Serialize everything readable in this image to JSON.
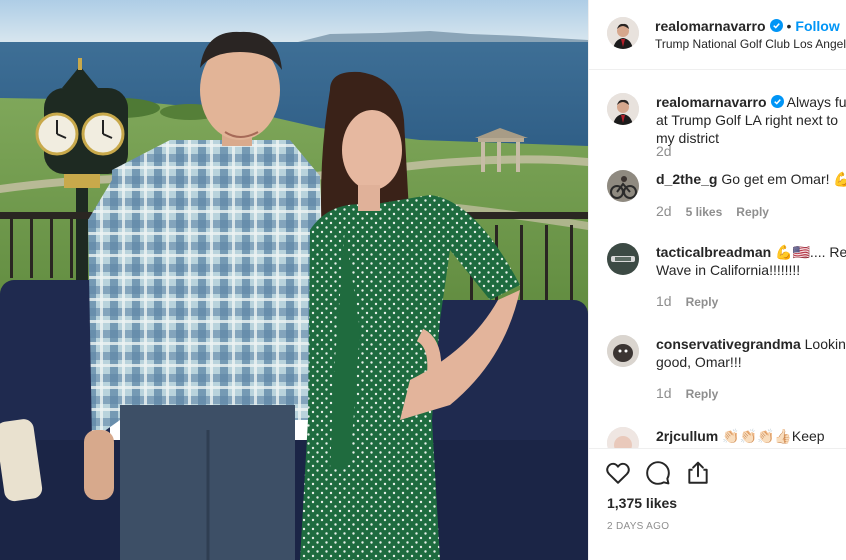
{
  "post": {
    "username": "realomarnavarro",
    "separator": "•",
    "follow_label": "Follow",
    "location": "Trump National Golf Club Los Angeles"
  },
  "comments": [
    {
      "username": "realomarnavarro",
      "text": "Always fun at Trump Golf LA right next to my district",
      "age": "2d",
      "likes": "",
      "reply": ""
    },
    {
      "username": "d_2the_g",
      "text": "Go get em Omar! 💪",
      "age": "2d",
      "likes": "5 likes",
      "reply": "Reply"
    },
    {
      "username": "tacticalbreadman",
      "text": "💪🇺🇸.... Red Wave in California!!!!!!!!",
      "age": "1d",
      "likes": "",
      "reply": "Reply"
    },
    {
      "username": "conservativegrandma",
      "text": "Looking good, Omar!!!",
      "age": "1d",
      "likes": "",
      "reply": "Reply"
    },
    {
      "username": "2rjcullum",
      "text": "👏🏻👏🏻👏🏻👍🏻Keep going",
      "age": "",
      "likes": "",
      "reply": ""
    }
  ],
  "actions": {
    "like_icon": "heart-icon",
    "comment_icon": "comment-icon",
    "share_icon": "share-icon"
  },
  "likes_count": "1,375 likes",
  "post_date": "2 DAYS AGO",
  "colors": {
    "accent": "#0095f6",
    "text": "#262626",
    "muted": "#8e8e8e",
    "border": "#efefef"
  }
}
